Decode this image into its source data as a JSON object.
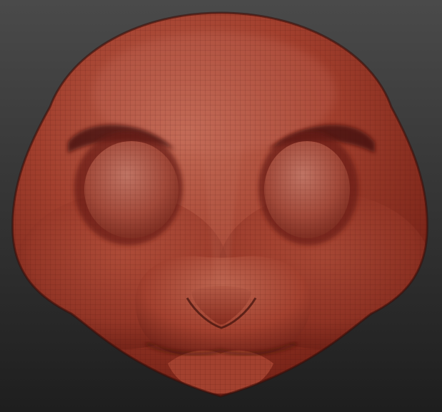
{
  "scene": {
    "background_top": "#4a4a4a",
    "background_bottom": "#1e1e1e",
    "model_base_color": "#9a3a2a",
    "model_highlight_color": "#c8705a",
    "model_shadow_color": "#4a1410",
    "wireframe_color": "#3a0e08",
    "subject": "sculpted-head-mesh"
  }
}
